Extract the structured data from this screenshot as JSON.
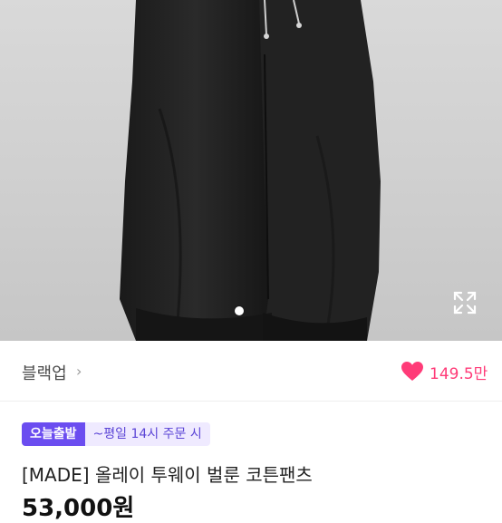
{
  "product": {
    "store_name": "블랙업",
    "store_chevron": "›",
    "like_count": "149.5만",
    "badge": "오늘출발",
    "badge_note": "~평일 14시 주문 시",
    "title": "[MADE] 올레이 투웨이 벌룬 코튼팬츠",
    "price": "53,000원",
    "colors": {
      "accent": "#6b4df0",
      "like": "#ff3b78"
    }
  },
  "icons": {
    "expand": "expand-icon",
    "heart": "heart-icon"
  }
}
